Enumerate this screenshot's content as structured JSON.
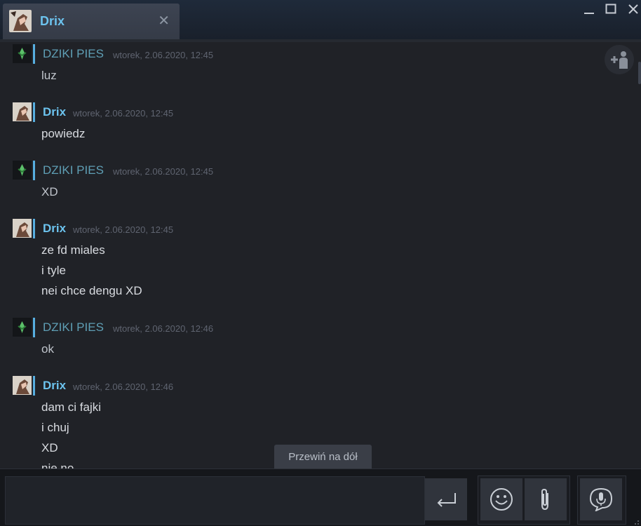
{
  "window": {
    "tab_title": "Drix",
    "close_glyph": "✕"
  },
  "messages": [
    {
      "sender": "DZIKI PIES",
      "kind": "dziki",
      "timestamp": "wtorek, 2.06.2020, 12:45",
      "lines": [
        "luz"
      ]
    },
    {
      "sender": "Drix",
      "kind": "drix",
      "timestamp": "wtorek, 2.06.2020, 12:45",
      "lines": [
        "powiedz"
      ]
    },
    {
      "sender": "DZIKI PIES",
      "kind": "dziki",
      "timestamp": "wtorek, 2.06.2020, 12:45",
      "lines": [
        "XD"
      ]
    },
    {
      "sender": "Drix",
      "kind": "drix",
      "timestamp": "wtorek, 2.06.2020, 12:45",
      "lines": [
        "ze fd miales",
        "i tyle",
        "nei chce dengu XD"
      ]
    },
    {
      "sender": "DZIKI PIES",
      "kind": "dziki",
      "timestamp": "wtorek, 2.06.2020, 12:46",
      "lines": [
        "ok"
      ]
    },
    {
      "sender": "Drix",
      "kind": "drix",
      "timestamp": "wtorek, 2.06.2020, 12:46",
      "lines": [
        "dam ci fajki",
        "i chuj",
        "XD",
        "nie no"
      ]
    }
  ],
  "jump_to_bottom": "Przewiń na dół",
  "composer": {
    "value": ""
  },
  "icons": {
    "send": "enter-icon",
    "emoji": "smiley-icon",
    "attach": "paperclip-icon",
    "voice": "microphone-icon",
    "add_friend": "add-friend-icon"
  },
  "colors": {
    "accent": "#6cc3ee",
    "dziki_name": "#5f9fb5",
    "background": "#202227"
  }
}
